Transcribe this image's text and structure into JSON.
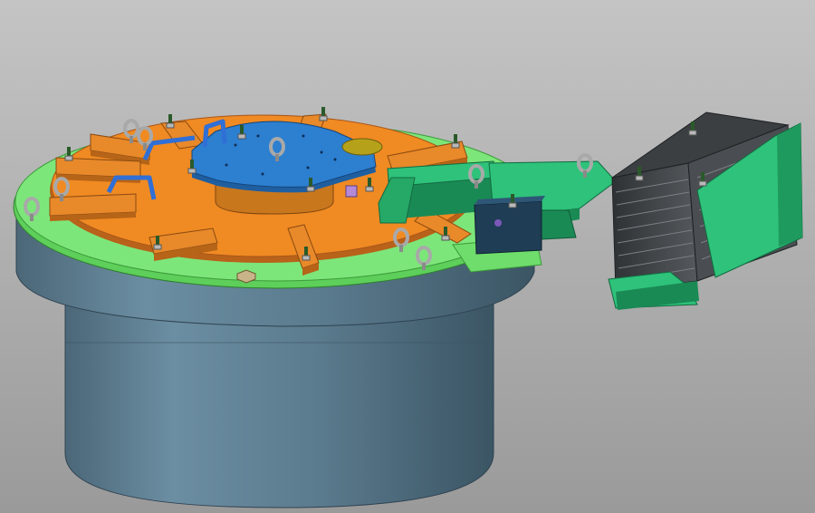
{
  "viewport": {
    "background_top": "#c4c4c4",
    "background_bottom": "#9a9a9a"
  },
  "colors": {
    "base_body": "#5f7f92",
    "base_shadow": "#3f5868",
    "flange_green": "#6de06a",
    "flange_edge": "#3c9a3a",
    "plate_orange": "#f08a22",
    "plate_orange_dark": "#b8621a",
    "clamp_orange": "#e8892a",
    "top_blue": "#2d7fd0",
    "top_blue_dark": "#1f5fa0",
    "hub_orange": "#d9831f",
    "arm_green": "#2ec27a",
    "arm_green_dark": "#1a8a55",
    "stack_dark": "#3a3d40",
    "stack_light": "#6a6e72",
    "block_navy": "#1f3d55",
    "bracket_olive": "#8d8a2a",
    "eyebolt_grey": "#a9a9a9",
    "handle_blue": "#2f6fd6",
    "bolt_green": "#2a5a2a",
    "accent_purple": "#b48ad8"
  },
  "icons": {
    "eye_bolt": "eye-bolt-icon",
    "hex_bolt": "hex-bolt-icon",
    "handle": "handle-icon"
  }
}
